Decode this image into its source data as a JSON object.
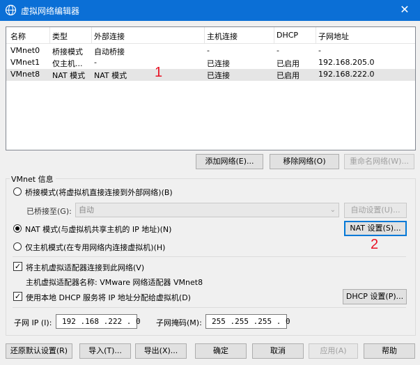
{
  "window": {
    "title": "虚拟网络编辑器",
    "close_glyph": "✕"
  },
  "table": {
    "headers": [
      "名称",
      "类型",
      "外部连接",
      "主机连接",
      "DHCP",
      "子网地址"
    ],
    "rows": [
      [
        "VMnet0",
        "桥接模式",
        "自动桥接",
        "-",
        "-",
        "-"
      ],
      [
        "VMnet1",
        "仅主机...",
        "-",
        "已连接",
        "已启用",
        "192.168.205.0"
      ],
      [
        "VMnet8",
        "NAT 模式",
        "NAT 模式",
        "已连接",
        "已启用",
        "192.168.222.0"
      ]
    ],
    "selected_row": 2
  },
  "annotations": {
    "mark1": "1",
    "mark2": "2"
  },
  "list_buttons": {
    "add": "添加网络(E)...",
    "remove": "移除网络(O)",
    "rename": "重命名网络(W)..."
  },
  "vmnet_info": {
    "title": "VMnet 信息",
    "bridge_label": "桥接模式(将虚拟机直接连接到外部网络)(B)",
    "bridged_to_label": "已桥接至(G):",
    "bridged_to_value": "自动",
    "auto_settings": "自动设置(U)...",
    "nat_label": "NAT 模式(与虚拟机共享主机的 IP 地址)(N)",
    "nat_settings": "NAT 设置(S)...",
    "hostonly_label": "仅主机模式(在专用网络内连接虚拟机)(H)",
    "connect_adapter_label": "将主机虚拟适配器连接到此网络(V)",
    "adapter_name_label": "主机虚拟适配器名称: VMware 网络适配器 VMnet8",
    "use_dhcp_label": "使用本地 DHCP 服务将 IP 地址分配给虚拟机(D)",
    "dhcp_settings": "DHCP 设置(P)...",
    "subnet_ip_label": "子网 IP (I):",
    "subnet_ip_value": "192 .168 .222 . 0",
    "subnet_mask_label": "子网掩码(M):",
    "subnet_mask_value": "255 .255 .255 . 0",
    "selected_mode": "nat",
    "connect_adapter_checked": true,
    "use_dhcp_checked": true
  },
  "footer": {
    "restore": "还原默认设置(R)",
    "import": "导入(T)...",
    "export": "导出(X)...",
    "ok": "确定",
    "cancel": "取消",
    "apply": "应用(A)",
    "help": "帮助"
  },
  "colors": {
    "titlebar": "#0b6fd6",
    "annotation": "#e81123",
    "focus": "#0078d7"
  }
}
